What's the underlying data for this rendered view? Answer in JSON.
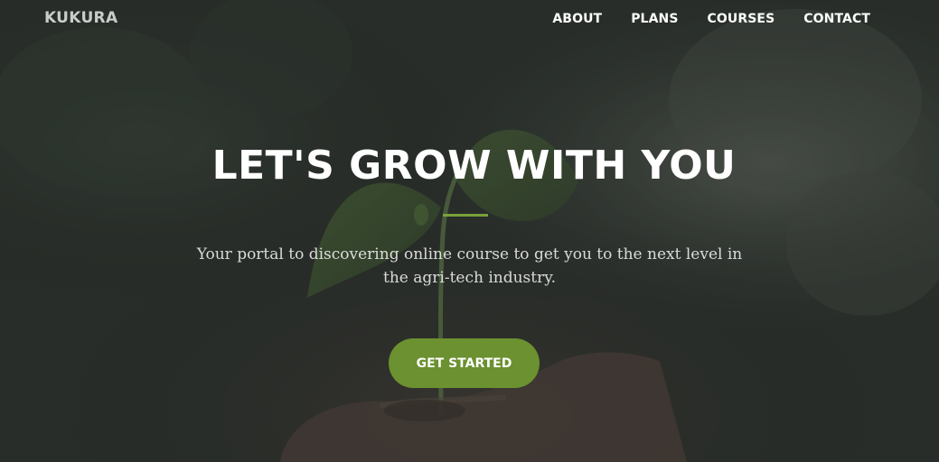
{
  "brand": {
    "name": "KUKURA"
  },
  "nav": {
    "items": [
      {
        "label": "ABOUT"
      },
      {
        "label": "PLANS"
      },
      {
        "label": "COURSES"
      },
      {
        "label": "CONTACT"
      }
    ]
  },
  "hero": {
    "title": "LET'S GROW WITH YOU",
    "subtitle": "Your portal to discovering online course to get you to the next level in the agri-tech industry.",
    "cta_label": "GET STARTED"
  },
  "colors": {
    "accent": "#6b9130",
    "divider": "#78a03a",
    "overlay": "#2a2f2b"
  }
}
